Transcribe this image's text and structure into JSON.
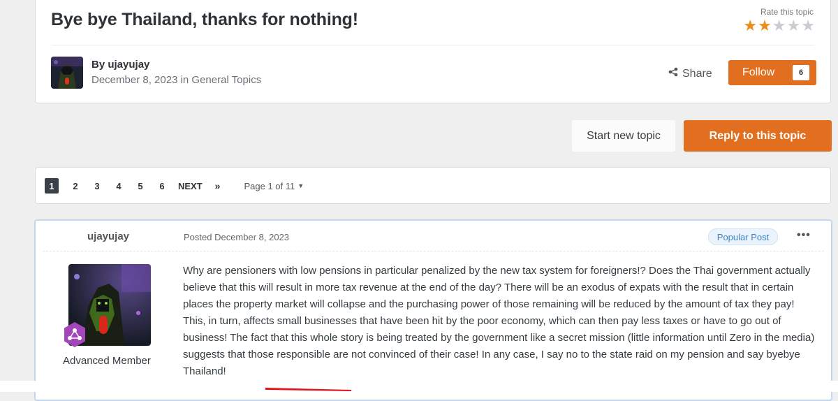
{
  "topic": {
    "title": "Bye bye Thailand, thanks for nothing!",
    "rate_label": "Rate this topic",
    "rating": 2,
    "rating_max": 5,
    "author_prefix": "By ",
    "author": "ujayujay",
    "date": "December 8, 2023",
    "date_in": " in ",
    "forum": "General Topics",
    "share_label": "Share",
    "follow_label": "Follow",
    "follow_count": "6"
  },
  "actions": {
    "start_topic_label": "Start new topic",
    "reply_label": "Reply to this topic"
  },
  "pagination": {
    "pages": [
      "1",
      "2",
      "3",
      "4",
      "5",
      "6"
    ],
    "active_page": "1",
    "next_label": "NEXT",
    "last_label": "»",
    "page_info": "Page 1 of 11"
  },
  "post": {
    "author": "ujayujay",
    "posted_date": "Posted December 8, 2023",
    "badge": "Popular Post",
    "member_title": "Advanced Member",
    "body": "Why are pensioners with low pensions in particular penalized by the new tax system for foreigners!? Does the Thai government actually believe that this will result in more tax revenue at the end of the day? There will be an exodus of expats with the result that in certain places the property market will collapse and the purchasing power of those remaining will be reduced by the amount of tax they pay! This, in turn, affects small businesses that have been hit by the poor economy, which can then pay less taxes or have to go out of business! The fact that this whole story is being treated by the government like a secret mission (little information until Zero in the media) suggests that those responsible are not convinced of their case! In any case, I say no to the state raid on my pension and say byebye Thailand!"
  },
  "colors": {
    "accent": "#e26f1f",
    "star_on": "#e88f16",
    "star_off": "#c9cdd1",
    "badge_text": "#3d82c4",
    "rank_badge": "#a246b8",
    "annotation": "#e0161f"
  },
  "icons": {
    "share": "share-icon",
    "more": "ellipsis-icon",
    "rank": "rank-badge-icon",
    "page_jump": "caret-down-icon"
  }
}
